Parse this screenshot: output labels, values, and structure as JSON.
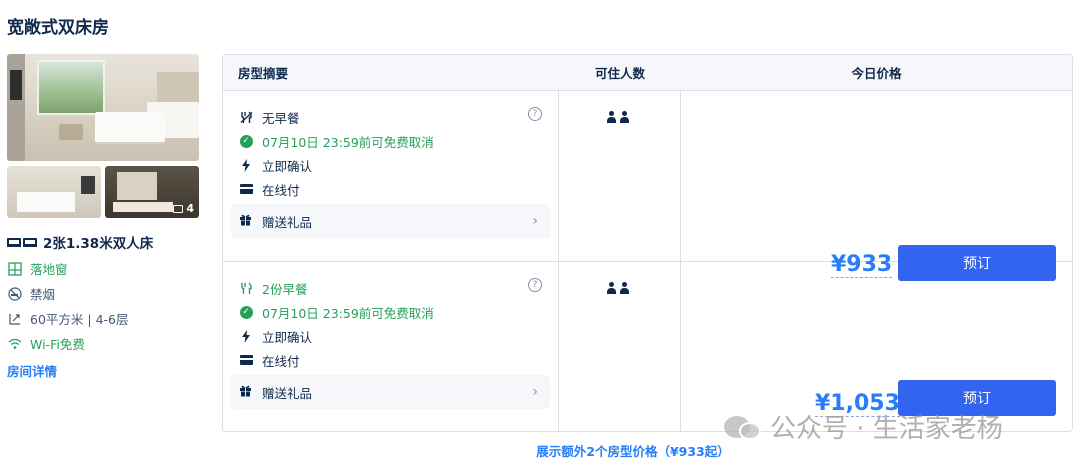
{
  "room": {
    "title": "宽敞式双床房",
    "photo_count": "4",
    "bed": "2张1.38米双人床",
    "features": [
      {
        "icon": "window-icon",
        "text": "落地窗"
      },
      {
        "icon": "no-smoking-icon",
        "text": "禁烟"
      },
      {
        "icon": "area-icon",
        "text": "60平方米 | 4-6层"
      },
      {
        "icon": "wifi-icon",
        "text": "Wi-Fi免费"
      }
    ],
    "details_link": "房间详情"
  },
  "table": {
    "headers": {
      "summary": "房型摘要",
      "occupancy": "可住人数",
      "price": "今日价格"
    },
    "rows": [
      {
        "meal": "无早餐",
        "cancel": "07月10日 23:59前可免费取消",
        "confirm": "立即确认",
        "payment": "在线付",
        "gift": "赠送礼品",
        "price": "¥933",
        "book": "预订"
      },
      {
        "meal": "2份早餐",
        "cancel": "07月10日 23:59前可免费取消",
        "confirm": "立即确认",
        "payment": "在线付",
        "gift": "赠送礼品",
        "price": "¥1,053",
        "book": "预订"
      }
    ]
  },
  "more_link": "展示额外2个房型价格（¥933起）",
  "watermark": "公众号 · 生活家老杨",
  "colors": {
    "accent": "#3264f0",
    "price": "#287dfa",
    "green": "#24a05a",
    "text": "#0f294d"
  }
}
